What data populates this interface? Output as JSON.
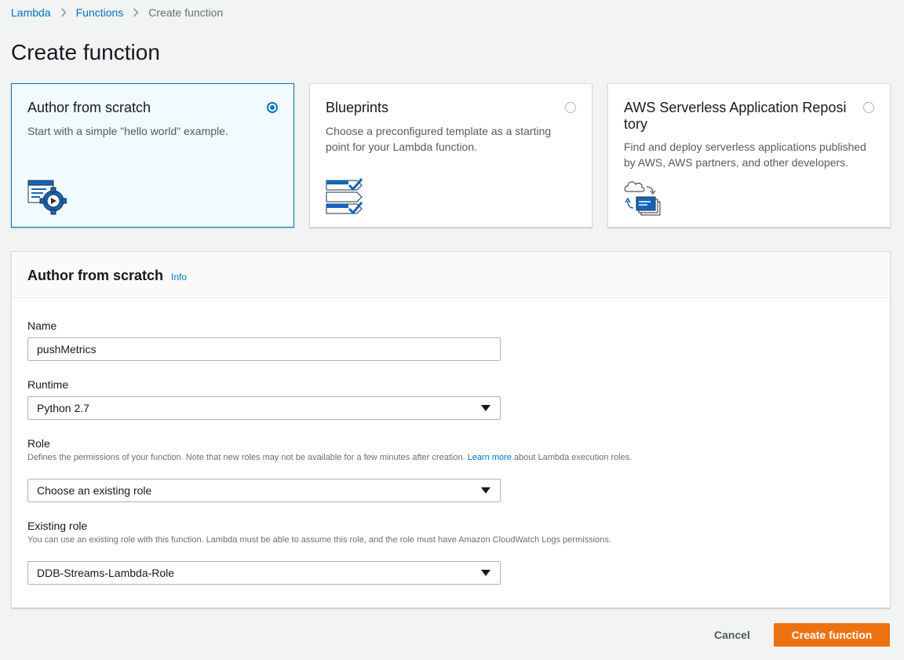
{
  "breadcrumb": {
    "items": [
      "Lambda",
      "Functions"
    ],
    "current": "Create function"
  },
  "page": {
    "title": "Create function"
  },
  "options": [
    {
      "title": "Author from scratch",
      "description": "Start with a simple \"hello world\" example.",
      "selected": true,
      "icon": "author-from-scratch-icon"
    },
    {
      "title": "Blueprints",
      "description": "Choose a preconfigured template as a starting point for your Lambda function.",
      "selected": false,
      "icon": "blueprints-icon"
    },
    {
      "title": "AWS Serverless Application Reposi tory",
      "description": "Find and deploy serverless applications published by AWS, AWS partners, and other developers.",
      "selected": false,
      "icon": "serverless-repository-icon"
    }
  ],
  "form": {
    "title": "Author from scratch",
    "info_link": "Info",
    "name": {
      "label": "Name",
      "value": "pushMetrics"
    },
    "runtime": {
      "label": "Runtime",
      "value": "Python 2.7"
    },
    "role": {
      "label": "Role",
      "description_before": "Defines the permissions of your function. Note that new roles may not be available for a few minutes after creation.",
      "learn_more": "Learn more",
      "description_after": "about Lambda execution roles.",
      "value": "Choose an existing role"
    },
    "existing_role": {
      "label": "Existing role",
      "description": "You can use an existing role with this function. Lambda must be able to assume this role, and the role must have Amazon CloudWatch Logs permissions.",
      "value": "DDB-Streams-Lambda-Role"
    }
  },
  "footer": {
    "cancel_label": "Cancel",
    "create_label": "Create function"
  },
  "colors": {
    "accent": "#0073bb",
    "primary_button": "#ec7211",
    "selected_card_bg": "#f1faff",
    "background": "#f2f3f3"
  }
}
